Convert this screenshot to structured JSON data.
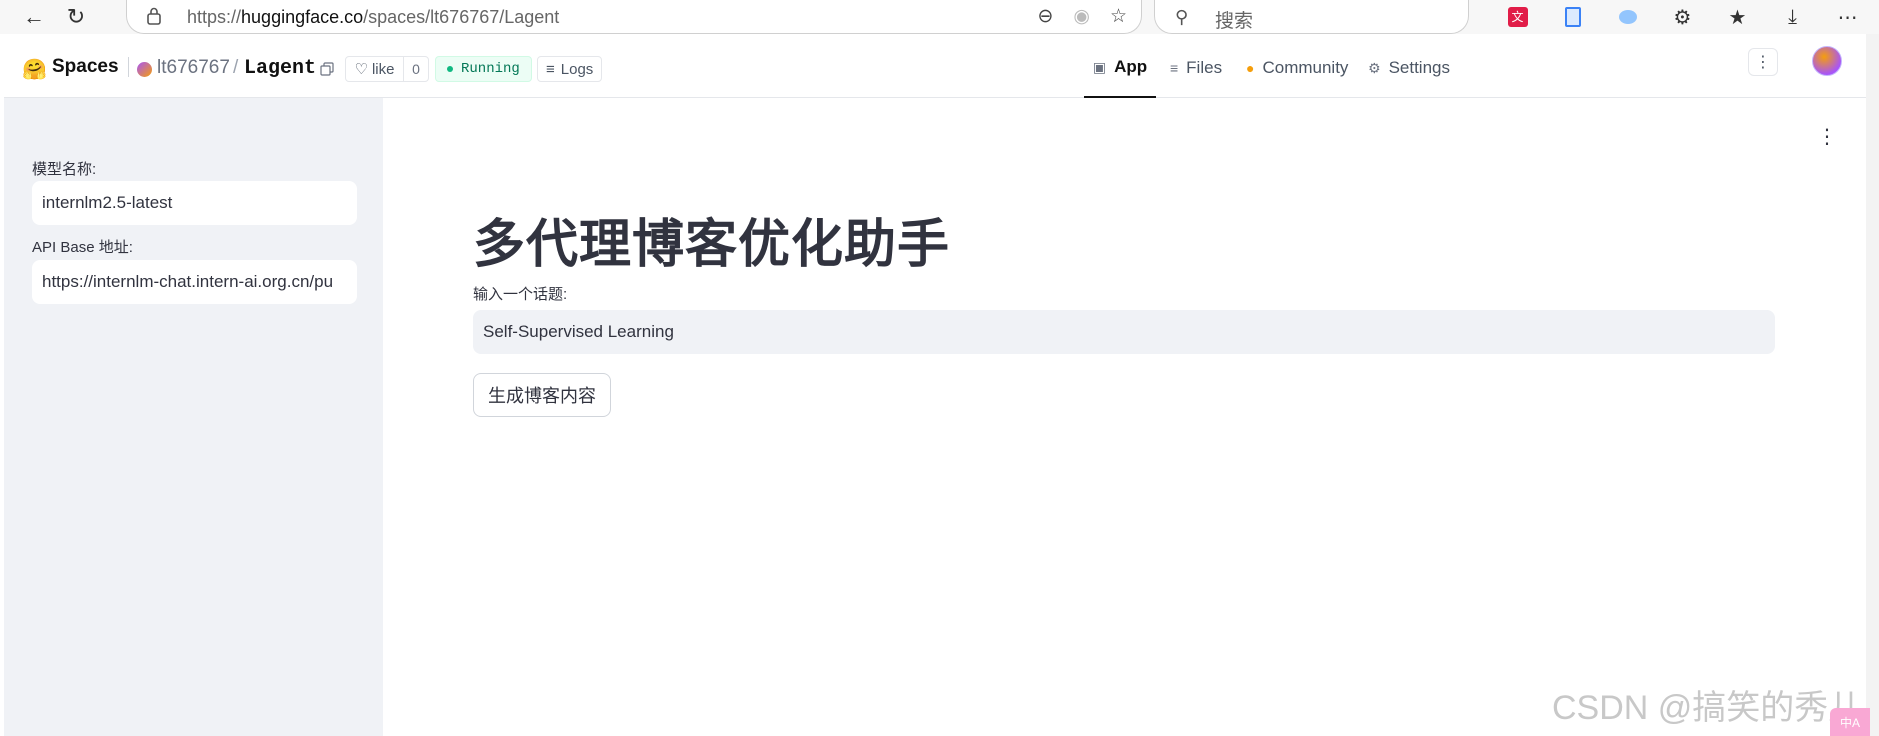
{
  "browser": {
    "url_prefix": "https://",
    "url_host": "huggingface.co",
    "url_path": "/spaces/lt676767/Lagent",
    "search_placeholder": "搜索"
  },
  "header": {
    "spaces_label": "Spaces",
    "owner": "lt676767",
    "separator": "/",
    "space_name": "Lagent",
    "like_label": "like",
    "like_count": "0",
    "status": "Running",
    "logs_label": "Logs",
    "tabs": [
      {
        "label": "App",
        "icon": "cube-icon",
        "active": true
      },
      {
        "label": "Files",
        "icon": "files-icon",
        "active": false
      },
      {
        "label": "Community",
        "icon": "community-icon",
        "active": false
      },
      {
        "label": "Settings",
        "icon": "gear-icon",
        "active": false
      }
    ]
  },
  "sidebar": {
    "model_label": "模型名称:",
    "model_value": "internlm2.5-latest",
    "api_label": "API Base 地址:",
    "api_value": "https://internlm-chat.intern-ai.org.cn/pu"
  },
  "main": {
    "title": "多代理博客优化助手",
    "topic_label": "输入一个话题:",
    "topic_value": "Self-Supervised Learning",
    "generate_button": "生成博客内容"
  },
  "watermark": "CSDN @搞笑的秀儿",
  "colors": {
    "sidebar_bg": "#f0f2f6",
    "running_green": "#047857",
    "text": "#31333f"
  }
}
